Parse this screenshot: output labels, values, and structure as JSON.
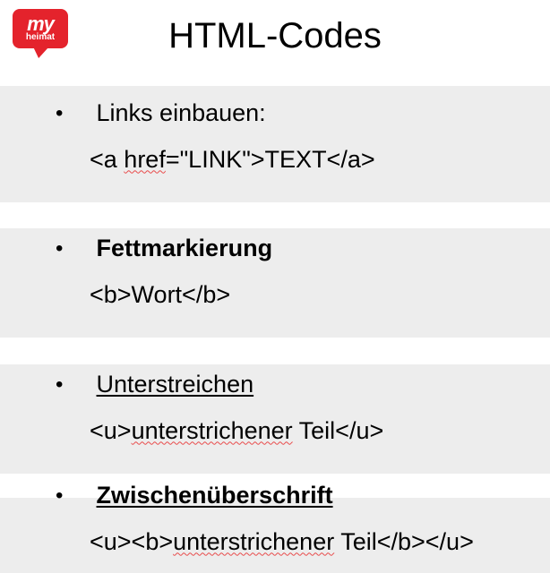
{
  "logo": {
    "main": "my",
    "sub": "heimat"
  },
  "title": "HTML-Codes",
  "sections": [
    {
      "heading": "Links einbauen:",
      "code": "<a href=\"LINK\">TEXT</a>",
      "style": "plain"
    },
    {
      "heading": "Fettmarkierung",
      "code": "<b>Wort</b>",
      "style": "bold"
    },
    {
      "heading": "Unterstreichen",
      "code": "<u>unterstrichener Teil</u>",
      "style": "underline"
    },
    {
      "heading": "Zwischenüberschrift",
      "code": "<u><b>unterstrichener Teil</b></u>",
      "style": "bold-underline"
    }
  ]
}
